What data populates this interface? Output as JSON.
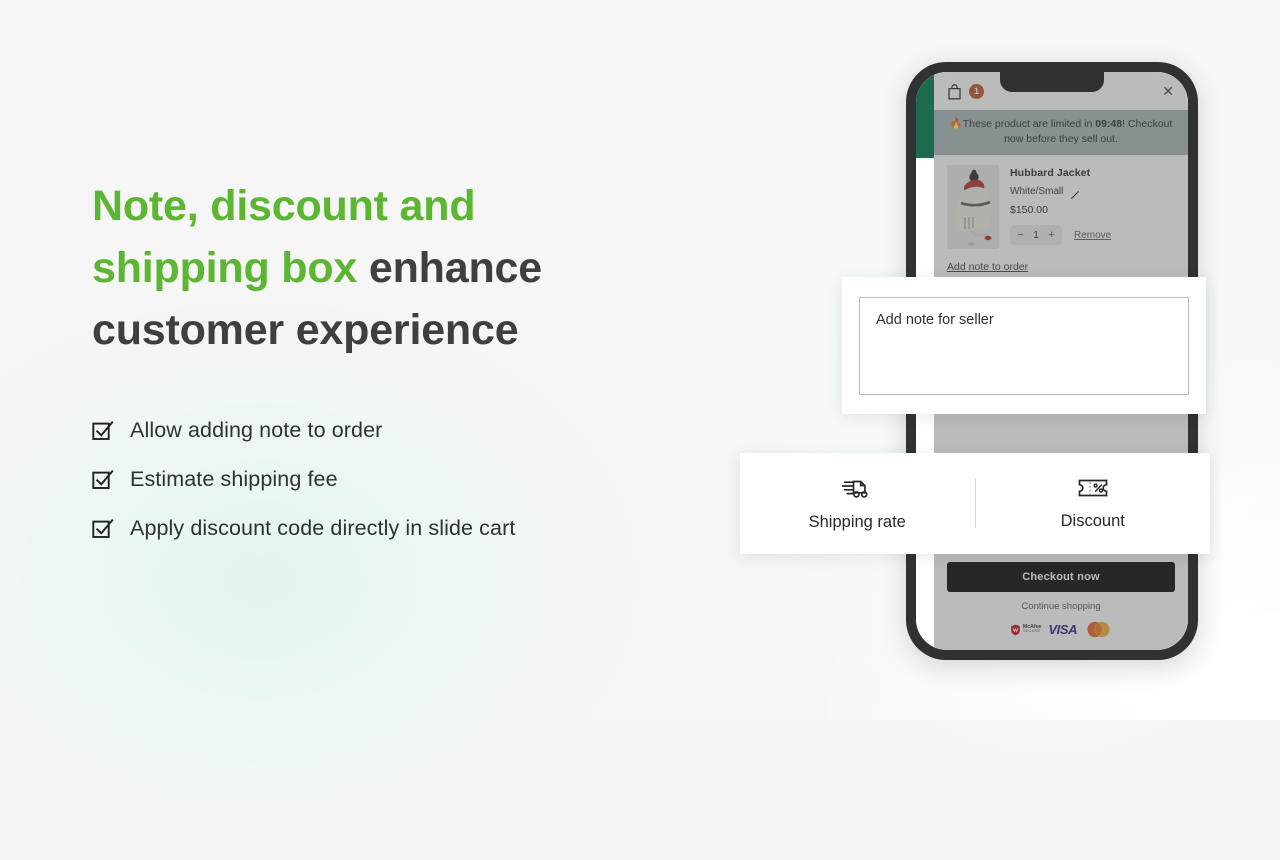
{
  "background": {
    "base_color": "#f5f6f5",
    "mint_glow_color": "#e3f5ee"
  },
  "hero": {
    "headline_highlight_1": "Note, discount and",
    "headline_highlight_2": "shipping box",
    "headline_rest_1": "enhance",
    "headline_rest_2": "customer experience",
    "highlight_color": "#5cb632",
    "text_color": "#3d3f41",
    "features": [
      {
        "icon": "checkbox-check-icon",
        "label": "Allow adding note to order"
      },
      {
        "icon": "checkbox-check-icon",
        "label": "Estimate shipping fee"
      },
      {
        "icon": "checkbox-check-icon",
        "label": "Apply discount code directly in slide cart"
      }
    ]
  },
  "phone": {
    "cart": {
      "bag_icon": "shopping-bag-icon",
      "badge_count": "1",
      "badge_color": "#c0501f",
      "close_icon": "close-icon",
      "promo_prefix": "🔥",
      "promo_text_before": "These product are limited in ",
      "promo_countdown": "09:48",
      "promo_text_after": "! Checkout now before they sell out.",
      "promo_bg_color": "#aab5b8",
      "item": {
        "title": "Hubbard Jacket",
        "variant": "White/Small",
        "edit_icon": "pencil-icon",
        "price": "$150.00",
        "decrease_label": "−",
        "quantity": "1",
        "increase_label": "+",
        "remove_label": "Remove"
      },
      "add_note_link": "Add note to order",
      "checkout_label": "Checkout now",
      "continue_label": "Continue shopping",
      "trust_badges": [
        {
          "name": "mcafee-secure-badge",
          "line1": "McAfee",
          "line2": "SECURE"
        },
        {
          "name": "visa-badge",
          "label": "VISA"
        },
        {
          "name": "mastercard-badge",
          "label": ""
        }
      ]
    }
  },
  "popups": {
    "note_card": {
      "textarea_placeholder": "Add note for seller",
      "textarea_value": ""
    },
    "shipping_discount_card": {
      "left": {
        "icon": "delivery-truck-icon",
        "label": "Shipping rate"
      },
      "right": {
        "icon": "coupon-percent-icon",
        "label": "Discount"
      }
    }
  }
}
